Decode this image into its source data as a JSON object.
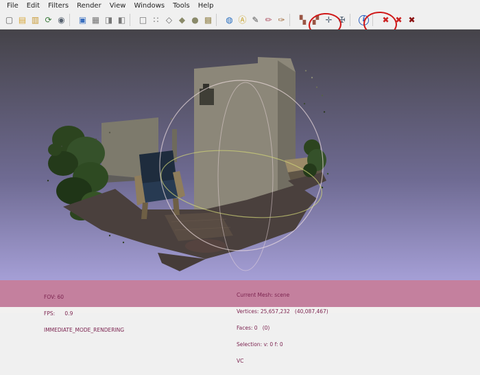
{
  "menu": {
    "items": [
      "File",
      "Edit",
      "Filters",
      "Render",
      "View",
      "Windows",
      "Tools",
      "Help"
    ]
  },
  "toolbar": {
    "icons": [
      {
        "name": "new-project",
        "glyph": "▢",
        "color": "#5a5a5a"
      },
      {
        "name": "open-project",
        "glyph": "▤",
        "color": "#d8a83c"
      },
      {
        "name": "save-project",
        "glyph": "▥",
        "color": "#c89a34"
      },
      {
        "name": "reload-mesh",
        "glyph": "⟳",
        "color": "#3a7a3a"
      },
      {
        "name": "save-snapshot",
        "glyph": "◉",
        "color": "#55606e"
      },
      {
        "type": "sep"
      },
      {
        "name": "show-layers",
        "glyph": "▣",
        "color": "#3a6fbf"
      },
      {
        "name": "show-rasters",
        "glyph": "▦",
        "color": "#777777"
      },
      {
        "name": "split-view",
        "glyph": "◨",
        "color": "#777777"
      },
      {
        "name": "unsplit-view",
        "glyph": "◧",
        "color": "#777777"
      },
      {
        "type": "sep"
      },
      {
        "name": "bbox-render-mode",
        "glyph": "□",
        "color": "#666666"
      },
      {
        "name": "points-render-mode",
        "glyph": "∷",
        "color": "#666666"
      },
      {
        "name": "wireframe-render-mode",
        "glyph": "◇",
        "color": "#666666"
      },
      {
        "name": "flat-render-mode",
        "glyph": "◆",
        "color": "#8a8a6a"
      },
      {
        "name": "smooth-render-mode",
        "glyph": "●",
        "color": "#8a8a6a"
      },
      {
        "name": "texture-render-mode",
        "glyph": "▩",
        "color": "#998a55"
      },
      {
        "type": "sep"
      },
      {
        "name": "globe-decoration",
        "glyph": "◍",
        "color": "#2a6fbf"
      },
      {
        "name": "letter-a-decoration",
        "glyph": "Ⓐ",
        "color": "#c9a227"
      },
      {
        "name": "measure-tool",
        "glyph": "✎",
        "color": "#555555"
      },
      {
        "name": "paint-tool",
        "glyph": "✏",
        "color": "#b05566"
      },
      {
        "name": "fill-tool",
        "glyph": "✑",
        "color": "#a06a3a"
      },
      {
        "type": "sep"
      },
      {
        "name": "select-vertices",
        "glyph": "▚",
        "color": "#995544"
      },
      {
        "name": "select-faces",
        "glyph": "▞",
        "color": "#995544"
      },
      {
        "name": "manipulator-tool",
        "glyph": "✛",
        "color": "#556677"
      },
      {
        "name": "align-tool",
        "glyph": "✠",
        "color": "#556677"
      },
      {
        "type": "sep"
      },
      {
        "name": "layer-info",
        "glyph": "i",
        "color": "#2a5fbf",
        "framed": true
      },
      {
        "type": "sep"
      },
      {
        "name": "delete-current-mesh",
        "glyph": "✖",
        "color": "#cc2222"
      },
      {
        "name": "delete-all-meshes",
        "glyph": "✖",
        "color": "#cc2222"
      },
      {
        "name": "delete-rasters",
        "glyph": "✖",
        "color": "#8a1111"
      }
    ]
  },
  "statusbar": {
    "left_lines": [
      "FOV: 60",
      "FPS:      0.9",
      "IMMEDIATE_MODE_RENDERING"
    ],
    "right_lines": [
      "Current Mesh: scene",
      "Vertices: 25,657,232   (40,087,467)",
      "Faces: 0   (0)",
      "Selection: v: 0 f: 0",
      "VC"
    ]
  },
  "colors": {
    "toolbar-bg": "#f0f0f0",
    "menu-text": "#222222",
    "viewport-top": "#454349",
    "viewport-mid": "#6f6b93",
    "viewport-bottom": "#a59fd6",
    "status-band": "#c4809e",
    "status-text": "#7c2450",
    "annotation-red": "#d01818"
  }
}
